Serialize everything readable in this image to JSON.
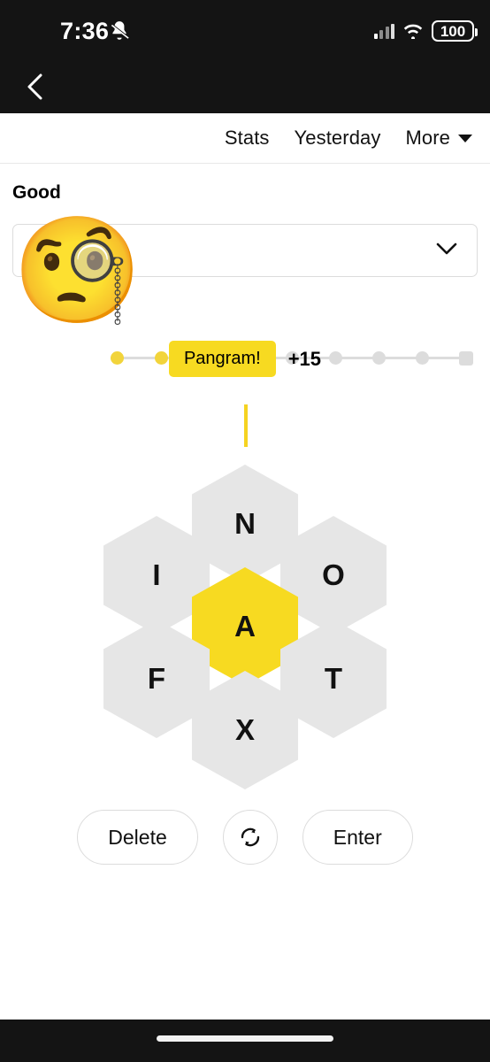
{
  "status_bar": {
    "time": "7:36",
    "mute_icon": "bell-slash-icon",
    "signal_icon": "cellular-signal-icon",
    "wifi_icon": "wifi-icon",
    "battery_level": "100"
  },
  "nav": {
    "back_icon": "chevron-left-icon"
  },
  "header": {
    "stats_label": "Stats",
    "yesterday_label": "Yesterday",
    "more_label": "More",
    "more_caret_icon": "caret-down-icon"
  },
  "progress": {
    "rank_label": "Good",
    "current_score": "15",
    "dots": [
      {
        "state": "filled"
      },
      {
        "state": "filled"
      },
      {
        "state": "filled"
      },
      {
        "state": "current"
      },
      {
        "state": "empty"
      },
      {
        "state": "empty"
      },
      {
        "state": "empty"
      },
      {
        "state": "empty"
      },
      {
        "state": "end"
      }
    ]
  },
  "word_list": {
    "value": "",
    "chevron_icon": "chevron-down-icon",
    "emoji": "🧐",
    "emoji_name": "face-with-monocle-emoji"
  },
  "message": {
    "badge_label": "Pangram!",
    "points_label": "+15"
  },
  "input": {
    "value": "",
    "cursor_visible": true
  },
  "hive": {
    "center_letter": "A",
    "outer_letters": [
      "N",
      "O",
      "T",
      "X",
      "F",
      "I"
    ],
    "cells": [
      {
        "letter": "N",
        "position": "top",
        "center": false
      },
      {
        "letter": "I",
        "position": "upper-left",
        "center": false
      },
      {
        "letter": "O",
        "position": "upper-right",
        "center": false
      },
      {
        "letter": "A",
        "position": "center",
        "center": true
      },
      {
        "letter": "F",
        "position": "lower-left",
        "center": false
      },
      {
        "letter": "T",
        "position": "lower-right",
        "center": false
      },
      {
        "letter": "X",
        "position": "bottom",
        "center": false
      }
    ]
  },
  "controls": {
    "delete_label": "Delete",
    "shuffle_icon": "shuffle-refresh-icon",
    "enter_label": "Enter"
  },
  "colors": {
    "accent_yellow": "#f7da21",
    "cell_gray": "#e6e6e6",
    "dark_chrome": "#141414"
  }
}
